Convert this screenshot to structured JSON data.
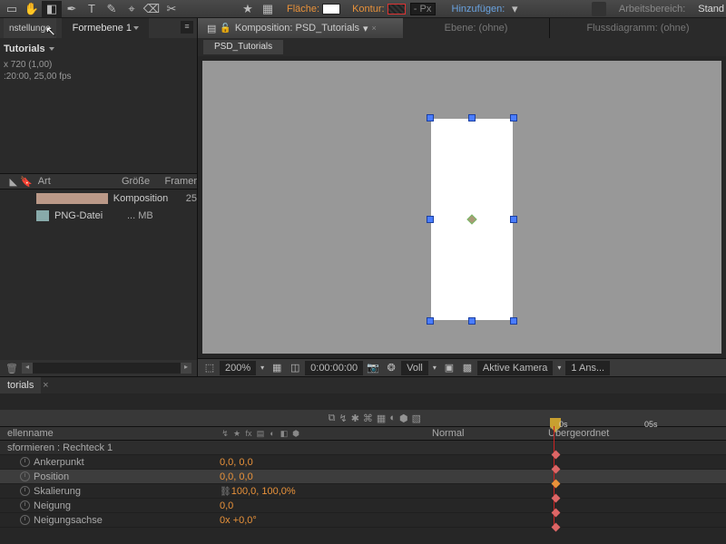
{
  "toolbar": {
    "fill_label": "Fläche:",
    "stroke_label": "Kontur:",
    "stroke_px": "- Px",
    "add_label": "Hinzufügen:",
    "workspace_label": "Arbeitsbereich:",
    "workspace_value": "Stand"
  },
  "project": {
    "tab1": "nstellunge",
    "crumb": "Formebene 1",
    "title": "Tutorials",
    "res": "x 720 (1,00)",
    "duration": ":20:00, 25,00 fps",
    "cols": {
      "type": "Art",
      "size": "Größe",
      "fps": "Framer"
    },
    "rows": [
      {
        "icon": "comp",
        "type": "Komposition",
        "size": "25"
      },
      {
        "icon": "png",
        "type": "PNG-Datei",
        "size": "... MB"
      }
    ]
  },
  "comp": {
    "tab_active": "Komposition: PSD_Tutorials",
    "tab_layer": "Ebene: (ohne)",
    "tab_flow": "Flussdiagramm: (ohne)",
    "crumb": "PSD_Tutorials"
  },
  "viewbar": {
    "zoom": "200%",
    "time": "0:00:00:00",
    "channel": "Voll",
    "camera": "Aktive Kamera",
    "views": "1 Ans..."
  },
  "timeline": {
    "tab": "torials",
    "ruler": {
      "t0": "0s",
      "t1": "05s"
    },
    "col_source": "ellenname",
    "col_mode": "Normal",
    "col_parent": "Übergeordnet",
    "group": "sformieren : Rechteck 1",
    "props": {
      "anchor": {
        "label": "Ankerpunkt",
        "value": "0,0, 0,0"
      },
      "position": {
        "label": "Position",
        "value": "0,0, 0,0"
      },
      "scale": {
        "label": "Skalierung",
        "value": "100,0, 100,0%"
      },
      "skew": {
        "label": "Neigung",
        "value": "0,0"
      },
      "skewaxis": {
        "label": "Neigungsachse",
        "value": "0x +0,0°"
      }
    }
  }
}
